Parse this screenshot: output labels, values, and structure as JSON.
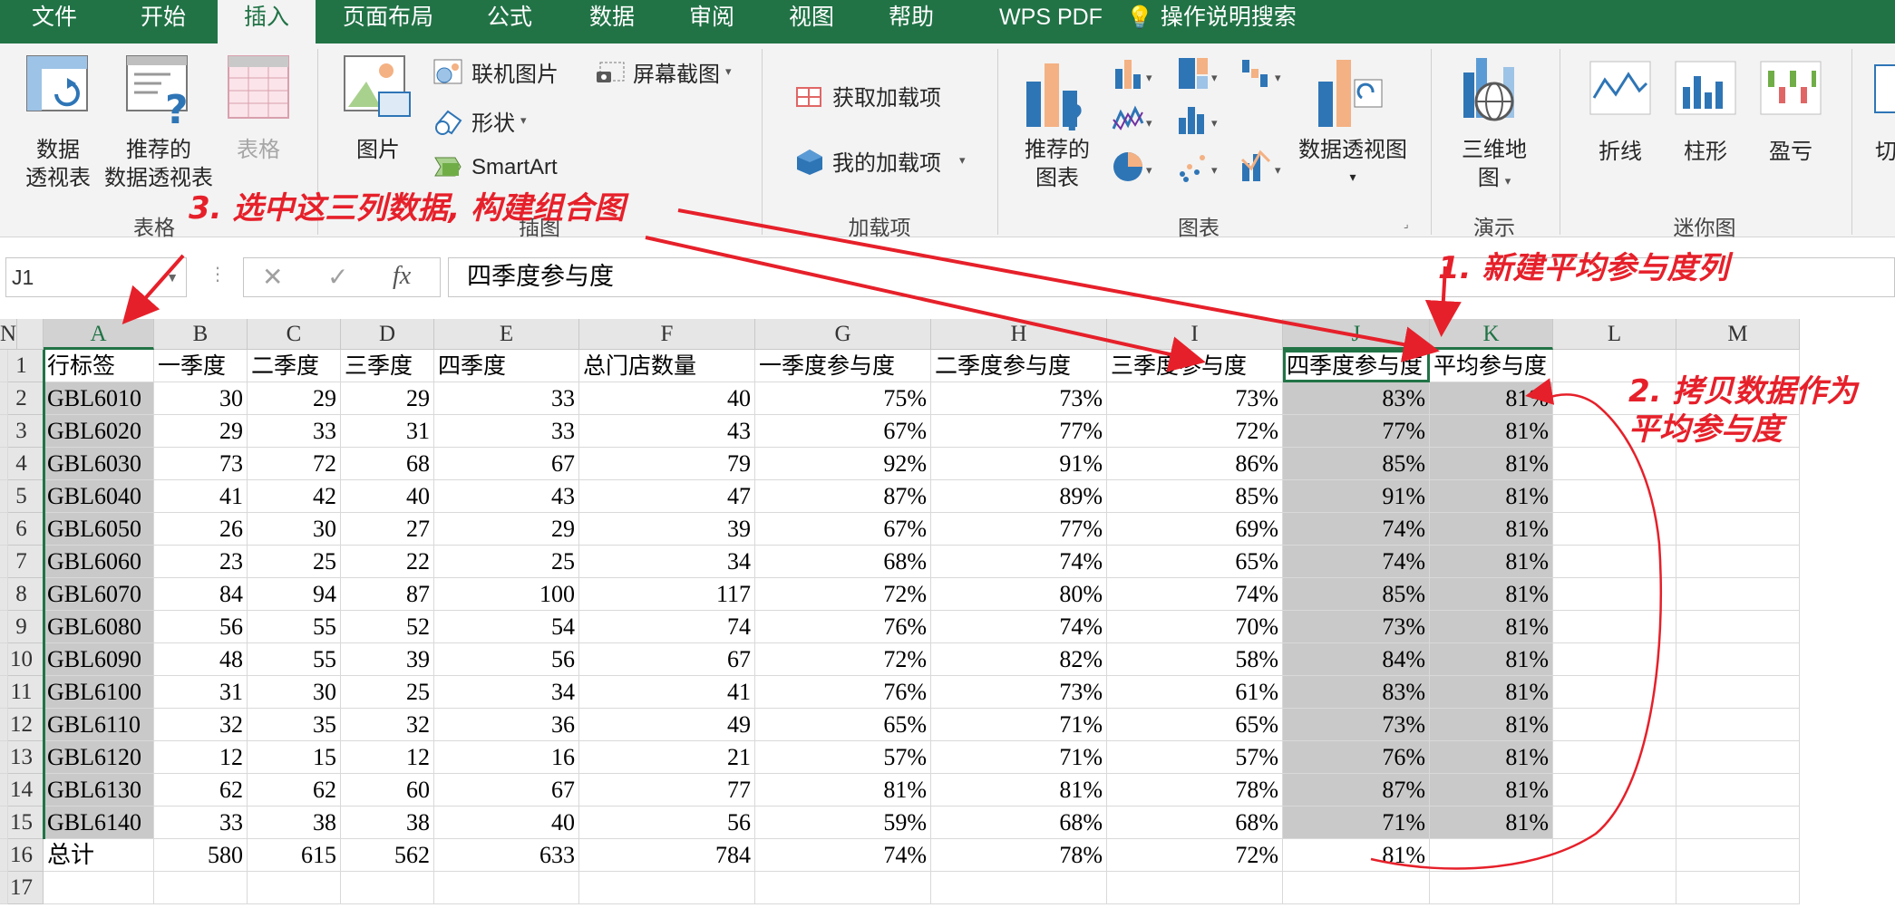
{
  "menu_tabs": [
    "文件",
    "开始",
    "插入",
    "页面布局",
    "公式",
    "数据",
    "审阅",
    "视图",
    "帮助",
    "WPS PDF",
    "操作说明搜索"
  ],
  "ribbon": {
    "pivot_table": [
      "数据",
      "透视表"
    ],
    "recommended_pivot": [
      "推荐的",
      "数据透视表"
    ],
    "table": "表格",
    "group_tables": "表格",
    "picture": "图片",
    "online_pictures": "联机图片",
    "shapes": "形状",
    "screenshot": "屏幕截图",
    "smartart": "SmartArt",
    "group_illustrations": "插图",
    "get_addins": "获取加载项",
    "my_addins": "我的加载项",
    "group_addins": "加载项",
    "recommended_charts": [
      "推荐的",
      "图表"
    ],
    "pivot_chart": "数据透视图",
    "group_charts": "图表",
    "map3d": [
      "三维地",
      "图"
    ],
    "group_tours": "演示",
    "sparkline_line": "折线",
    "sparkline_column": "柱形",
    "sparkline_winloss": "盈亏",
    "group_sparklines": "迷你图",
    "cut_off": "切"
  },
  "formula_bar": {
    "name_box": "J1",
    "cancel": "✕",
    "enter": "✓",
    "fx": "fx",
    "content": "四季度参与度"
  },
  "columns": [
    "A",
    "B",
    "C",
    "D",
    "E",
    "F",
    "G",
    "H",
    "I",
    "J",
    "K",
    "L",
    "M",
    "N"
  ],
  "rows": [
    [
      "行标签",
      "一季度",
      "二季度",
      "三季度",
      "四季度",
      "总门店数量",
      "一季度参与度",
      "二季度参与度",
      "三季度参与度",
      "四季度参与度",
      "平均参与度"
    ],
    [
      "GBL6010",
      "30",
      "29",
      "29",
      "33",
      "40",
      "75%",
      "73%",
      "73%",
      "83%",
      "81%"
    ],
    [
      "GBL6020",
      "29",
      "33",
      "31",
      "33",
      "43",
      "67%",
      "77%",
      "72%",
      "77%",
      "81%"
    ],
    [
      "GBL6030",
      "73",
      "72",
      "68",
      "67",
      "79",
      "92%",
      "91%",
      "86%",
      "85%",
      "81%"
    ],
    [
      "GBL6040",
      "41",
      "42",
      "40",
      "43",
      "47",
      "87%",
      "89%",
      "85%",
      "91%",
      "81%"
    ],
    [
      "GBL6050",
      "26",
      "30",
      "27",
      "29",
      "39",
      "67%",
      "77%",
      "69%",
      "74%",
      "81%"
    ],
    [
      "GBL6060",
      "23",
      "25",
      "22",
      "25",
      "34",
      "68%",
      "74%",
      "65%",
      "74%",
      "81%"
    ],
    [
      "GBL6070",
      "84",
      "94",
      "87",
      "100",
      "117",
      "72%",
      "80%",
      "74%",
      "85%",
      "81%"
    ],
    [
      "GBL6080",
      "56",
      "55",
      "52",
      "54",
      "74",
      "76%",
      "74%",
      "70%",
      "73%",
      "81%"
    ],
    [
      "GBL6090",
      "48",
      "55",
      "39",
      "56",
      "67",
      "72%",
      "82%",
      "58%",
      "84%",
      "81%"
    ],
    [
      "GBL6100",
      "31",
      "30",
      "25",
      "34",
      "41",
      "76%",
      "73%",
      "61%",
      "83%",
      "81%"
    ],
    [
      "GBL6110",
      "32",
      "35",
      "32",
      "36",
      "49",
      "65%",
      "71%",
      "65%",
      "73%",
      "81%"
    ],
    [
      "GBL6120",
      "12",
      "15",
      "12",
      "16",
      "21",
      "57%",
      "71%",
      "57%",
      "76%",
      "81%"
    ],
    [
      "GBL6130",
      "62",
      "62",
      "60",
      "67",
      "77",
      "81%",
      "81%",
      "78%",
      "87%",
      "81%"
    ],
    [
      "GBL6140",
      "33",
      "38",
      "38",
      "40",
      "56",
      "59%",
      "68%",
      "68%",
      "71%",
      "81%"
    ],
    [
      "总计",
      "580",
      "615",
      "562",
      "633",
      "784",
      "74%",
      "78%",
      "72%",
      "81%",
      ""
    ],
    [
      "",
      "",
      "",
      "",
      "",
      "",
      "",
      "",
      "",
      "",
      ""
    ]
  ],
  "annotations": {
    "step1": "1. 新建平均参与度列",
    "step2": [
      "2. 拷贝数据作为",
      "平均参与度"
    ],
    "step3": "3. 选中这三列数据, 构建组合图"
  },
  "colors": {
    "excel_green": "#217346",
    "annotation_red": "#e6202a",
    "selection_gray": "#c9c9c9"
  }
}
